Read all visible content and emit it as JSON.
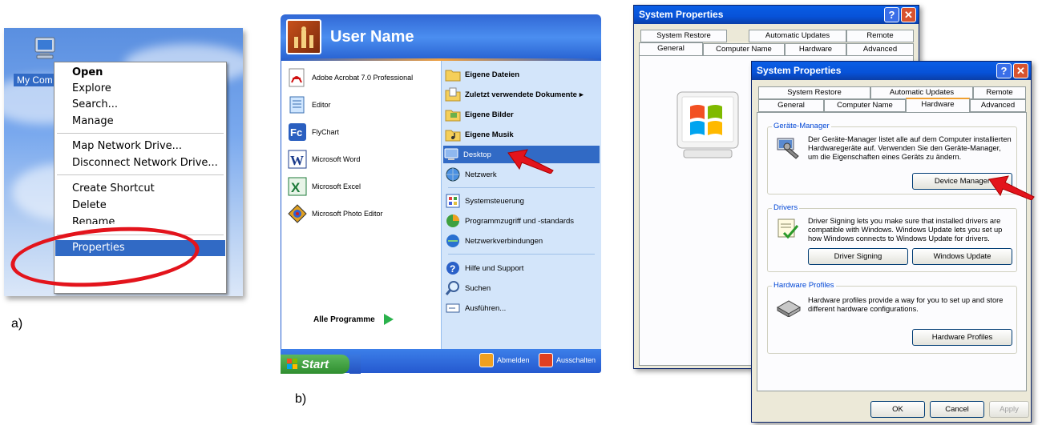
{
  "panel_a": {
    "desktop_icon_label": "My Com",
    "context_menu": {
      "items": [
        {
          "label": "Open",
          "bold": true
        },
        {
          "label": "Explore"
        },
        {
          "label": "Search..."
        },
        {
          "label": "Manage"
        },
        {
          "label": "Map Network Drive..."
        },
        {
          "label": "Disconnect Network Drive..."
        },
        {
          "label": "Create Shortcut"
        },
        {
          "label": "Delete"
        },
        {
          "label": "Rename"
        },
        {
          "label": "Properties",
          "selected": true
        }
      ]
    },
    "caption": "a)"
  },
  "panel_b": {
    "user_name": "User Name",
    "left_items": [
      {
        "label": "Adobe Acrobat 7.0 Professional",
        "icon": "acrobat-icon"
      },
      {
        "label": "Editor",
        "icon": "notepad-icon"
      },
      {
        "label": "FlyChart",
        "icon": "flychart-icon"
      },
      {
        "label": "Microsoft Word",
        "icon": "word-icon"
      },
      {
        "label": "Microsoft Excel",
        "icon": "excel-icon"
      },
      {
        "label": "Microsoft Photo Editor",
        "icon": "photo-editor-icon"
      }
    ],
    "all_programs": "Alle Programme",
    "right_items": [
      {
        "label": "Eigene Dateien",
        "bold": true,
        "icon": "folder-icon"
      },
      {
        "label": "Zuletzt verwendete Dokumente",
        "bold": true,
        "icon": "recent-docs-icon",
        "arrow": "▸"
      },
      {
        "label": "Eigene Bilder",
        "bold": true,
        "icon": "pictures-icon"
      },
      {
        "label": "Eigene Musik",
        "bold": true,
        "icon": "music-icon"
      },
      {
        "label": "Desktop",
        "selected": true,
        "icon": "desktop-icon"
      },
      {
        "label": "Netzwerk",
        "icon": "network-icon"
      },
      {
        "label": "Systemsteuerung",
        "icon": "control-panel-icon"
      },
      {
        "label": "Programmzugriff und -standards",
        "icon": "program-access-icon"
      },
      {
        "label": "Netzwerkverbindungen",
        "icon": "network-connections-icon"
      },
      {
        "label": "Hilfe und Support",
        "icon": "help-icon"
      },
      {
        "label": "Suchen",
        "icon": "search-icon"
      },
      {
        "label": "Ausführen...",
        "icon": "run-icon"
      }
    ],
    "logoff": "Abmelden",
    "shutdown": "Ausschalten",
    "start": "Start",
    "caption": "b)"
  },
  "panel_c": {
    "back_window": {
      "title": "System Properties",
      "tabs_top": [
        "System Restore",
        "Automatic Updates",
        "Remote"
      ],
      "tabs_bottom": [
        "General",
        "Computer Name",
        "Hardware",
        "Advanced"
      ],
      "active_tab": "General"
    },
    "front_window": {
      "title": "System Properties",
      "tabs_top": [
        "System Restore",
        "Automatic Updates",
        "Remote"
      ],
      "tabs_bottom": [
        "General",
        "Computer Name",
        "Hardware",
        "Advanced"
      ],
      "active_tab": "Hardware",
      "device_manager_group": {
        "label": "Geräte-Manager",
        "text": "Der Geräte-Manager listet alle auf dem Computer installierten Hardwaregeräte auf. Verwenden Sie den Geräte-Manager, um die Eigenschaften eines Geräts zu ändern.",
        "button": "Device Manager"
      },
      "drivers_group": {
        "label": "Drivers",
        "text": "Driver Signing lets you make sure that installed drivers are compatible with Windows. Windows Update lets you set up how Windows connects to Windows Update for drivers.",
        "button1": "Driver Signing",
        "button2": "Windows Update"
      },
      "hw_profiles_group": {
        "label": "Hardware Profiles",
        "text": "Hardware profiles provide a way for you to set up and store different hardware configurations.",
        "button": "Hardware Profiles"
      },
      "ok": "OK",
      "cancel": "Cancel",
      "apply": "Apply"
    }
  },
  "colors": {
    "highlight": "#316ac5",
    "annotation_red": "#e3141c",
    "xp_blue": "#0752d8"
  }
}
